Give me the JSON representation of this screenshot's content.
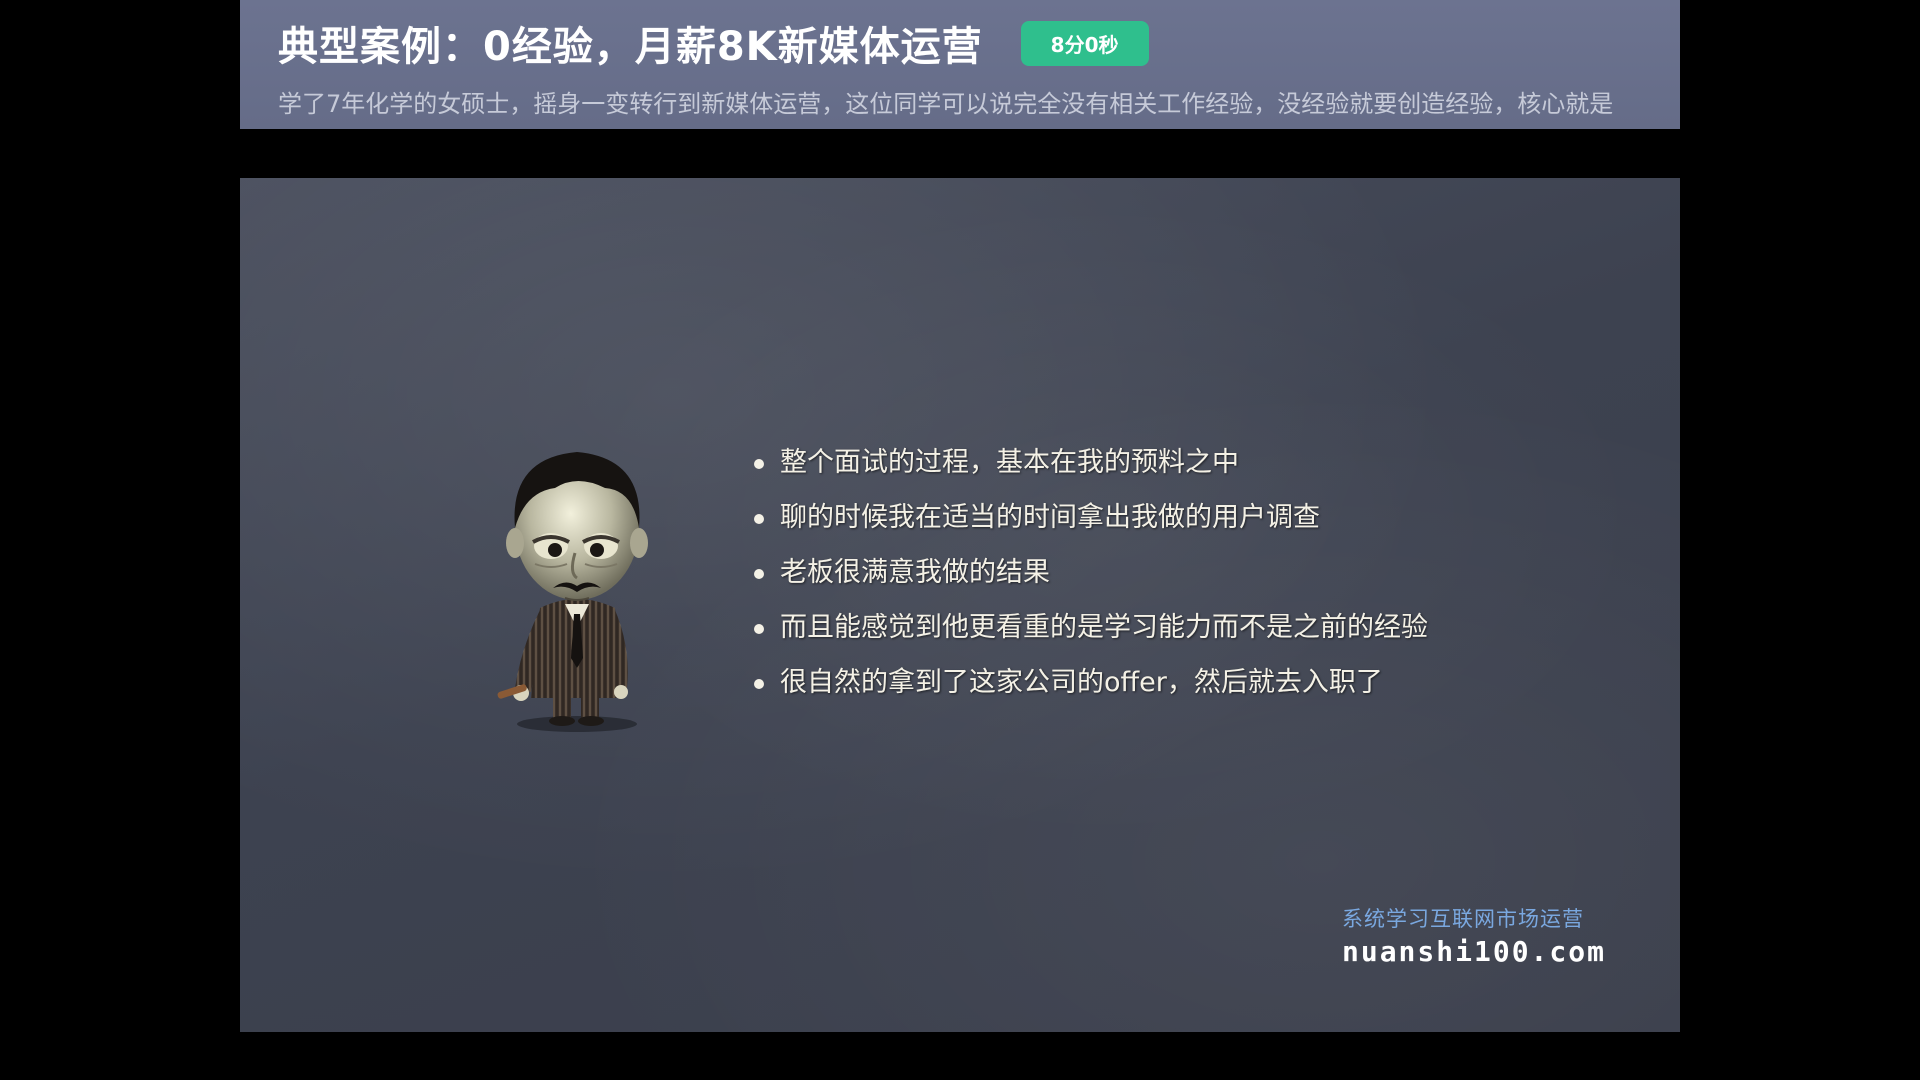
{
  "header": {
    "title": "典型案例：0经验，月薪8K新媒体运营",
    "duration": "8分0秒",
    "description": "学了7年化学的女硕士，摇身一变转行到新媒体运营，这位同学可以说完全没有相关工作经验，没经验就要创造经验，核心就是"
  },
  "slide": {
    "bullets": [
      "整个面试的过程，基本在我的预料之中",
      "聊的时候我在适当的时间拿出我做的用户调查",
      "老板很满意我做的结果",
      "而且能感觉到他更看重的是学习能力而不是之前的经验",
      "很自然的拿到了这家公司的offer，然后就去入职了"
    ],
    "character": "cartoon-businessman-illustration"
  },
  "watermark": {
    "slogan": "系统学习互联网市场运营",
    "site": "nuanshi100.com"
  },
  "colors": {
    "header_bg": "#656c88",
    "badge": "#2fbf8d",
    "chalkboard": "#3d4250",
    "slogan": "#7aa8e0"
  }
}
